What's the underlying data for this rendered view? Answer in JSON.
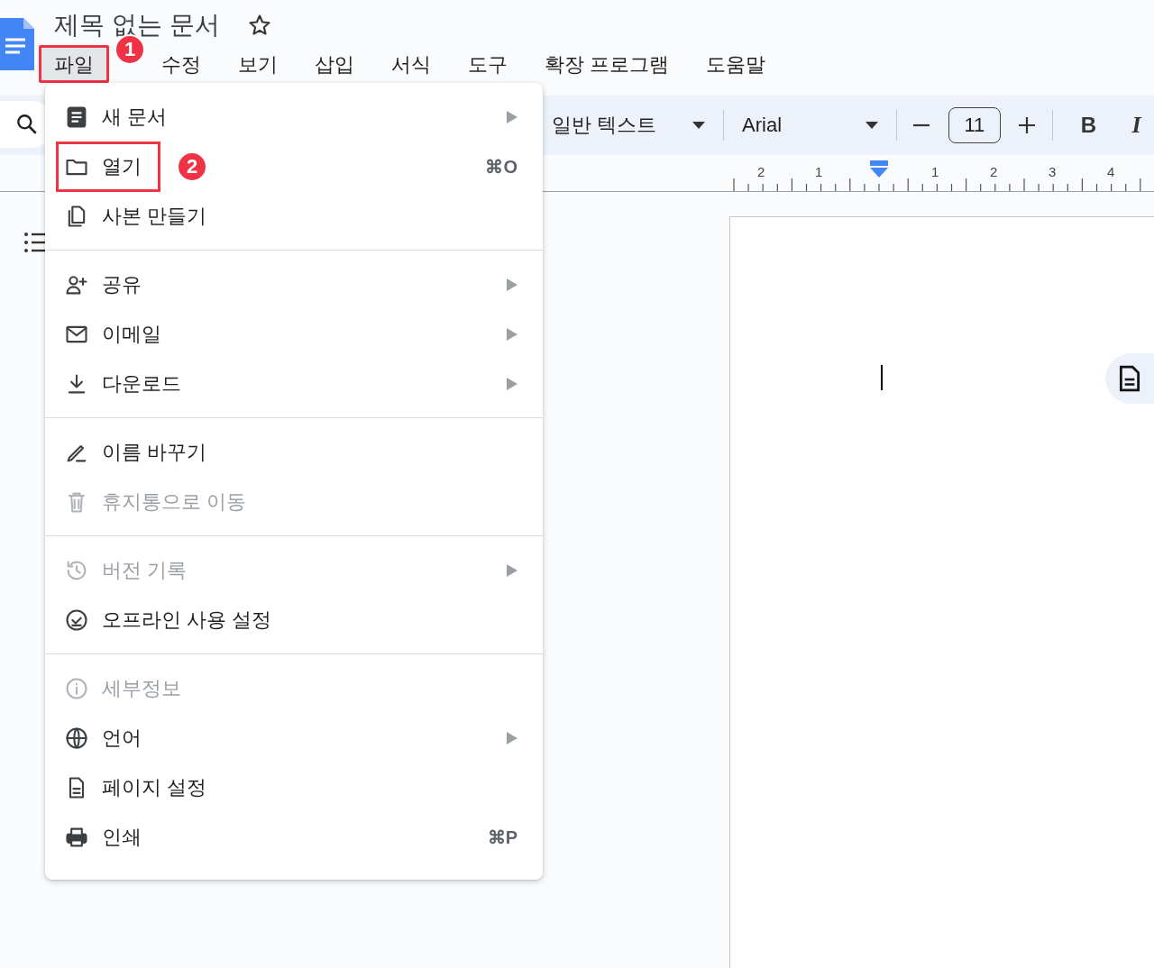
{
  "document": {
    "title": "제목 없는 문서",
    "starred": false
  },
  "menubar": [
    {
      "label": "파일",
      "selected": true,
      "marked": true,
      "badge": "1"
    },
    {
      "label": "수정",
      "selected": false,
      "marked": false
    },
    {
      "label": "보기",
      "selected": false,
      "marked": false
    },
    {
      "label": "삽입",
      "selected": false,
      "marked": false
    },
    {
      "label": "서식",
      "selected": false,
      "marked": false
    },
    {
      "label": "도구",
      "selected": false,
      "marked": false
    },
    {
      "label": "확장 프로그램",
      "selected": false,
      "marked": false
    },
    {
      "label": "도움말",
      "selected": false,
      "marked": false
    }
  ],
  "toolbar": {
    "style": "일반 텍스트",
    "font": "Arial",
    "font_size": "11",
    "bold": "B",
    "italic": "I"
  },
  "ruler": {
    "left_labels": [
      "2",
      "1"
    ],
    "right_labels": [
      "1",
      "2",
      "3",
      "4"
    ]
  },
  "file_menu": [
    [
      {
        "label": "새 문서",
        "submenu": true,
        "disabled": false,
        "marked": false
      },
      {
        "label": "열기",
        "shortcut": "⌘O",
        "submenu": false,
        "disabled": false,
        "marked": true,
        "badge": "2"
      },
      {
        "label": "사본 만들기",
        "submenu": false,
        "disabled": false,
        "marked": false
      }
    ],
    [
      {
        "label": "공유",
        "submenu": true,
        "disabled": false,
        "marked": false
      },
      {
        "label": "이메일",
        "submenu": true,
        "disabled": false,
        "marked": false
      },
      {
        "label": "다운로드",
        "submenu": true,
        "disabled": false,
        "marked": false
      }
    ],
    [
      {
        "label": "이름 바꾸기",
        "submenu": false,
        "disabled": false,
        "marked": false
      },
      {
        "label": "휴지통으로 이동",
        "submenu": false,
        "disabled": true,
        "marked": false
      }
    ],
    [
      {
        "label": "버전 기록",
        "submenu": true,
        "disabled": true,
        "marked": false
      },
      {
        "label": "오프라인 사용 설정",
        "submenu": false,
        "disabled": false,
        "marked": false
      }
    ],
    [
      {
        "label": "세부정보",
        "submenu": false,
        "disabled": true,
        "marked": false
      },
      {
        "label": "언어",
        "submenu": true,
        "disabled": false,
        "marked": false
      },
      {
        "label": "페이지 설정",
        "submenu": false,
        "disabled": false,
        "marked": false
      },
      {
        "label": "인쇄",
        "shortcut": "⌘P",
        "submenu": false,
        "disabled": false,
        "marked": false
      }
    ]
  ]
}
